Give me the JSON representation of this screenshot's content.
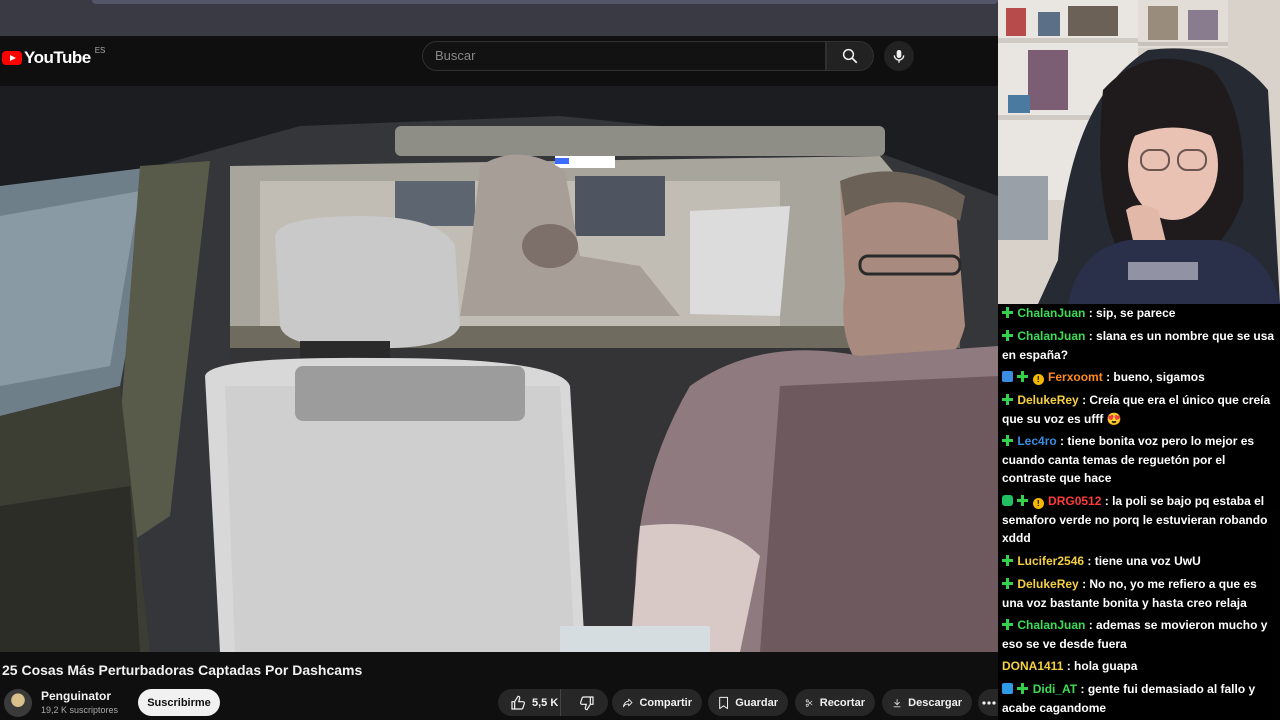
{
  "youtube": {
    "logo_text": "YouTube",
    "region_code": "ES",
    "search_placeholder": "Buscar",
    "video": {
      "title": "25 Cosas Más Perturbadoras Captadas Por Dashcams"
    },
    "channel": {
      "name": "Penguinator",
      "subscribers": "19,2 K suscriptores",
      "subscribe_label": "Suscribirme"
    },
    "actions": {
      "likes": "5,5 K",
      "share": "Compartir",
      "save": "Guardar",
      "clip": "Recortar",
      "download": "Descargar"
    }
  },
  "chat": {
    "colors": {
      "green": "#3ddc56",
      "orange": "#ff8a1f",
      "blue": "#3a8de0",
      "red": "#ff3b3b",
      "yellow": "#f5d142",
      "pink": "#ff7eb6"
    },
    "messages": [
      {
        "badges": [
          "plus"
        ],
        "user": "ChalanJuan",
        "color": "green",
        "text": ": sip, se parece"
      },
      {
        "badges": [
          "plus"
        ],
        "user": "ChalanJuan",
        "color": "green",
        "text": ": slana es un nombre que se usa en españa?"
      },
      {
        "badges": [
          "sq",
          "plus",
          "circle"
        ],
        "user": "Ferxoomt",
        "color": "orange",
        "text": ": bueno, sigamos"
      },
      {
        "badges": [
          "plus"
        ],
        "user": "DelukeRey",
        "color": "yellow",
        "text": ": Creía que era el único que creía que su voz es ufff 😍"
      },
      {
        "badges": [
          "plus"
        ],
        "user": "Lec4ro",
        "color": "blue",
        "text": ": tiene bonita voz pero lo mejor es cuando canta temas de reguetón por el contraste que hace"
      },
      {
        "badges": [
          "hex",
          "plus",
          "circle"
        ],
        "user": "DRG0512",
        "color": "red",
        "text": ": la poli se bajo pq estaba el semaforo verde no porq le estuvieran robando xddd"
      },
      {
        "badges": [
          "plus"
        ],
        "user": "Lucifer2546",
        "color": "yellow",
        "text": ": tiene una voz UwU"
      },
      {
        "badges": [
          "plus"
        ],
        "user": "DelukeRey",
        "color": "yellow",
        "text": ": No no, yo me refiero a que es una voz bastante bonita y hasta creo relaja"
      },
      {
        "badges": [
          "plus"
        ],
        "user": "ChalanJuan",
        "color": "green",
        "text": ": ademas se movieron mucho y eso se ve desde fuera"
      },
      {
        "badges": [],
        "user": "DONA1411",
        "color": "yellow",
        "text": ": hola guapa"
      },
      {
        "badges": [
          "cube",
          "plus"
        ],
        "user": "Didi_AT",
        "color": "green",
        "text": ": gente fui demasiado al fallo y acabe cagandome"
      }
    ]
  }
}
